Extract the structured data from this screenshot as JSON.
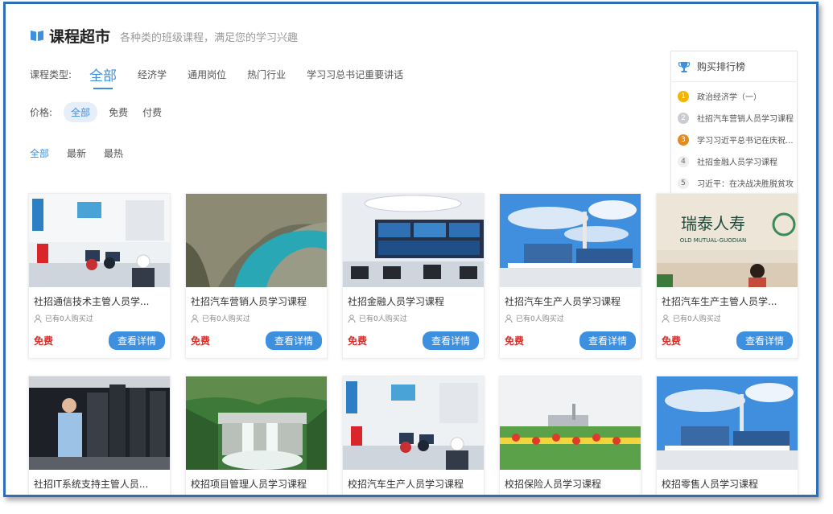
{
  "header": {
    "title": "课程超市",
    "subtitle": "各种类的班级课程，满足您的学习兴趣"
  },
  "filters": {
    "type_label": "课程类型:",
    "types": [
      "全部",
      "经济学",
      "通用岗位",
      "热门行业",
      "学习习总书记重要讲话"
    ],
    "price_label": "价格:",
    "prices": [
      "全部",
      "免费",
      "付费"
    ],
    "sorts": [
      "全部",
      "最新",
      "最热"
    ]
  },
  "ranking": {
    "title": "购买排行榜",
    "items": [
      {
        "rank": "1",
        "label": "政治经济学（一）"
      },
      {
        "rank": "2",
        "label": "社招汽车营销人员学习课程"
      },
      {
        "rank": "3",
        "label": "学习习近平总书记在庆祝..."
      },
      {
        "rank": "4",
        "label": "社招金融人员学习课程"
      },
      {
        "rank": "5",
        "label": "习近平：在决战决胜脱贫攻"
      }
    ]
  },
  "courses": [
    {
      "title": "社招通信技术主管人员学...",
      "buyers": "已有0人购买过",
      "price": "免费",
      "button": "查看详情"
    },
    {
      "title": "社招汽车营销人员学习课程",
      "buyers": "已有0人购买过",
      "price": "免费",
      "button": "查看详情"
    },
    {
      "title": "社招金融人员学习课程",
      "buyers": "已有0人购买过",
      "price": "免费",
      "button": "查看详情"
    },
    {
      "title": "社招汽车生产人员学习课程",
      "buyers": "已有0人购买过",
      "price": "免费",
      "button": "查看详情"
    },
    {
      "title": "社招汽车生产主管人员学...",
      "buyers": "已有0人购买过",
      "price": "免费",
      "button": "查看详情",
      "sign_text": "瑞泰人寿",
      "sign_sub": "OLD MUTUAL-GUODIAN"
    },
    {
      "title": "社招IT系统支持主管人员..."
    },
    {
      "title": "校招项目管理人员学习课程"
    },
    {
      "title": "校招汽车生产人员学习课程"
    },
    {
      "title": "校招保险人员学习课程"
    },
    {
      "title": "校招零售人员学习课程"
    }
  ],
  "colors": {
    "accent": "#3d8fe0",
    "price_red": "#d9302c",
    "frame_border": "#2f6db5"
  }
}
